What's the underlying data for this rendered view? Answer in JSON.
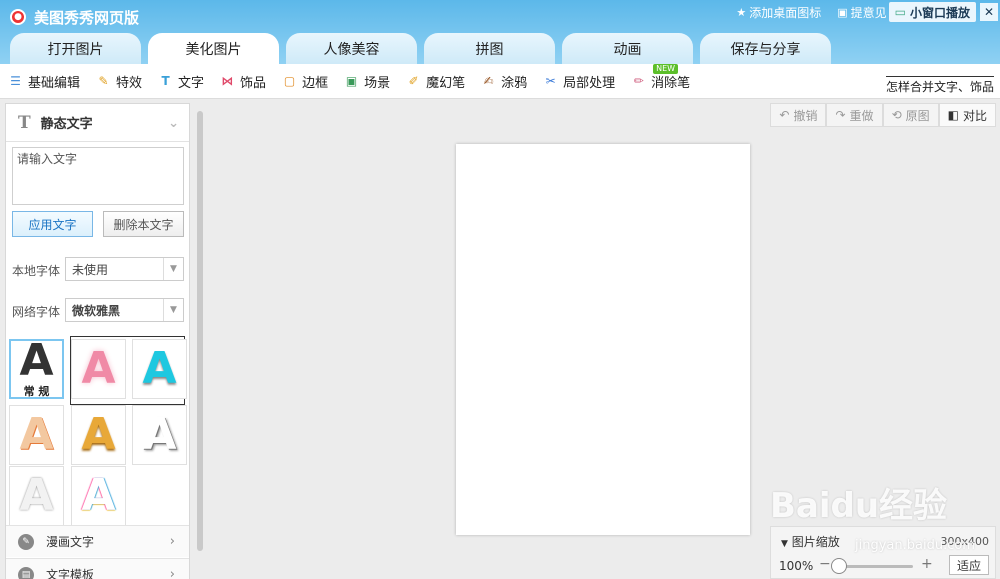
{
  "app": {
    "title": "美图秀秀网页版"
  },
  "top_links": {
    "add_desktop": "添加桌面图标",
    "feedback": "提意见",
    "mini_window": "小窗口播放",
    "close": "✕"
  },
  "tabs": [
    {
      "label": "打开图片"
    },
    {
      "label": "美化图片"
    },
    {
      "label": "人像美容"
    },
    {
      "label": "拼图"
    },
    {
      "label": "动画"
    },
    {
      "label": "保存与分享"
    }
  ],
  "toolbar": {
    "items": [
      {
        "label": "基础编辑",
        "icon": "sliders-icon"
      },
      {
        "label": "特效",
        "icon": "magic-wand-icon"
      },
      {
        "label": "文字",
        "icon": "text-t-icon"
      },
      {
        "label": "饰品",
        "icon": "bow-icon"
      },
      {
        "label": "边框",
        "icon": "frame-icon"
      },
      {
        "label": "场景",
        "icon": "picture-icon"
      },
      {
        "label": "魔幻笔",
        "icon": "magic-pen-icon"
      },
      {
        "label": "涂鸦",
        "icon": "brush-icon"
      },
      {
        "label": "局部处理",
        "icon": "clip-icon"
      },
      {
        "label": "消除笔",
        "icon": "eraser-pen-icon"
      }
    ],
    "new_badge": "NEW",
    "help": "怎样合并文字、饰品"
  },
  "panel": {
    "header": "静态文字",
    "text_placeholder": "请输入文字",
    "apply_button": "应用文字",
    "delete_button": "删除本文字",
    "local_font_label": "本地字体",
    "local_font_value": "未使用",
    "web_font_label": "网络字体",
    "web_font_value": "微软雅黑",
    "styles": [
      {
        "letter": "A",
        "caption": "常 规"
      },
      {
        "letter": "A",
        "caption": ""
      },
      {
        "letter": "A",
        "caption": ""
      },
      {
        "letter": "A",
        "caption": ""
      },
      {
        "letter": "A",
        "caption": ""
      },
      {
        "letter": "A",
        "caption": ""
      },
      {
        "letter": "A",
        "caption": ""
      },
      {
        "letter": "A",
        "caption": ""
      }
    ],
    "sections": [
      {
        "label": "漫画文字"
      },
      {
        "label": "文字模板"
      }
    ]
  },
  "workspace": {
    "undo": "撤销",
    "redo": "重做",
    "original": "原图",
    "compare": "对比",
    "zoom_title": "图片缩放",
    "image_size": "300x400",
    "zoom_percent": "100%",
    "zoom_level": 0.0,
    "fit_button": "适应"
  },
  "watermark": {
    "brand": "Baidu经验",
    "url": "jingyan.baidu.com"
  },
  "colors": {
    "title_bar": "#5cb8ea",
    "accent": "#1a74c4",
    "new_badge": "#5cbf2a"
  }
}
